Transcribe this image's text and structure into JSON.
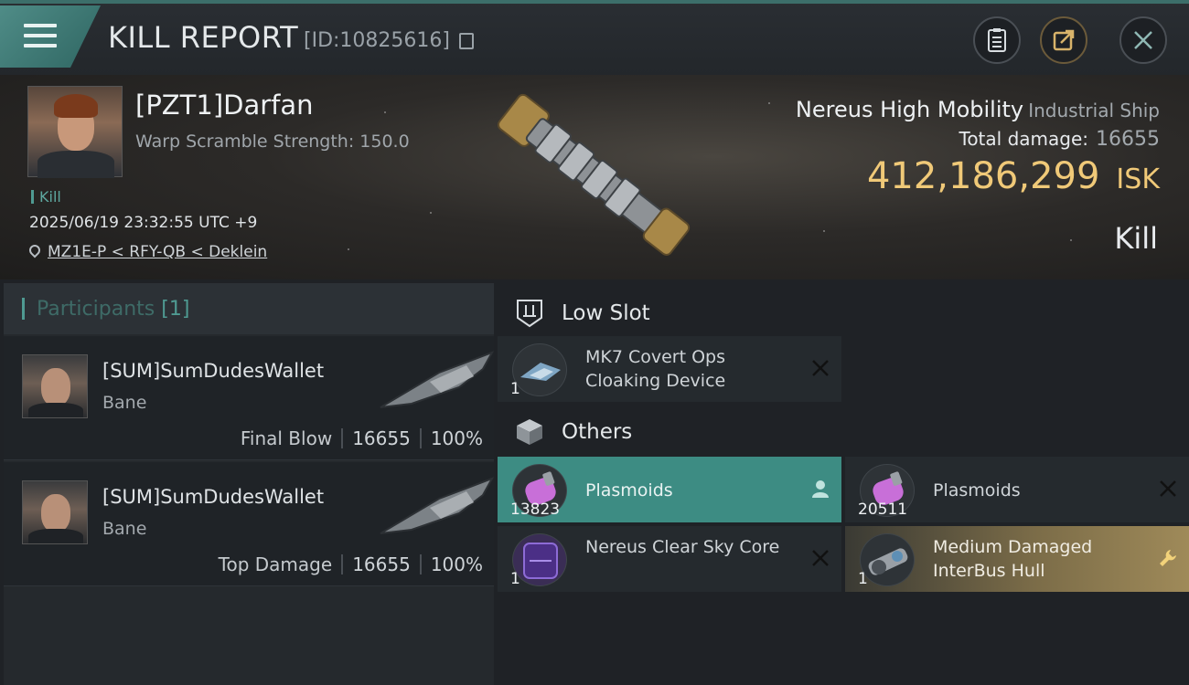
{
  "header": {
    "title": "KILL REPORT",
    "report_id": "[ID:10825616]"
  },
  "victim": {
    "name": "[PZT1]Darfan",
    "warp_scramble": "Warp Scramble Strength: 150.0",
    "kill_tag": "Kill",
    "timestamp": "2025/06/19 23:32:55 UTC +9",
    "location": "MZ1E-P < RFY-QB < Deklein"
  },
  "ship": {
    "name": "Nereus High Mobility",
    "class": "Industrial Ship",
    "total_damage_label": "Total damage:",
    "total_damage": "16655",
    "isk_value": "412,186,299",
    "isk_unit": "ISK",
    "result": "Kill"
  },
  "participants": {
    "title": "Participants",
    "count": "[1]",
    "rows": [
      {
        "name": "[SUM]SumDudesWallet",
        "ship": "Bane",
        "role": "Final Blow",
        "damage": "16655",
        "percent": "100%"
      },
      {
        "name": "[SUM]SumDudesWallet",
        "ship": "Bane",
        "role": "Top Damage",
        "damage": "16655",
        "percent": "100%"
      }
    ]
  },
  "sections": {
    "low_slot": {
      "title": "Low Slot",
      "items": [
        {
          "name": "MK7 Covert Ops Cloaking Device",
          "qty": "1",
          "status": "destroyed"
        }
      ]
    },
    "others": {
      "title": "Others",
      "items": [
        {
          "name": "Plasmoids",
          "qty": "13823",
          "status": "dropped"
        },
        {
          "name": "Plasmoids",
          "qty": "20511",
          "status": "destroyed"
        },
        {
          "name": "Nereus Clear Sky Core",
          "qty": "1",
          "status": "destroyed"
        },
        {
          "name": "Medium Damaged InterBus Hull",
          "qty": "1",
          "status": "fitted"
        }
      ]
    }
  },
  "colors": {
    "accent_teal": "#4f9a92",
    "dropped_teal": "#3d8c83",
    "isk_gold": "#f0c978",
    "fitted_gold": "#9f8a59"
  },
  "icons": {
    "menu": "hamburger-icon",
    "copy": "copy-icon",
    "clipboard": "clipboard-icon",
    "share": "share-icon",
    "close": "close-icon",
    "location": "location-pin-icon",
    "low_slot": "low-slot-icon",
    "others": "cube-icon",
    "destroyed": "x-icon",
    "dropped": "person-icon",
    "fitted": "wrench-icon"
  }
}
